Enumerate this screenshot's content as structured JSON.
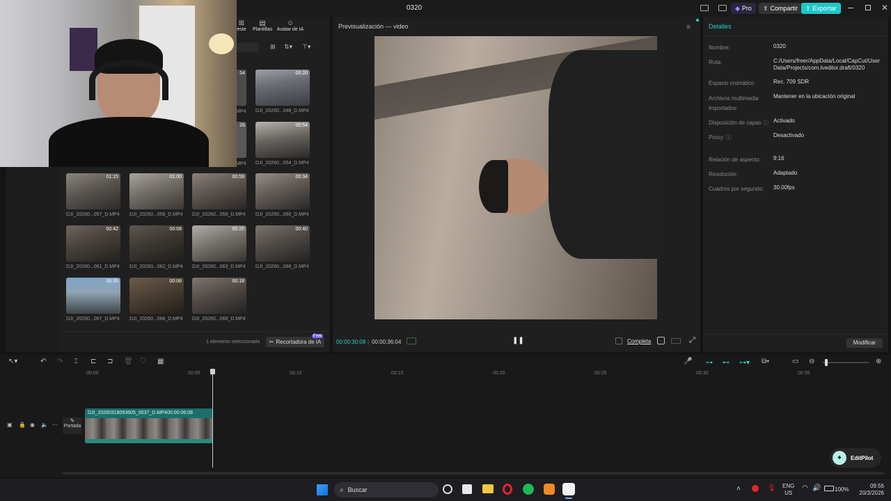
{
  "titlebar": {
    "title": "0320",
    "pro_label": "Pro",
    "share_label": "Compartir",
    "export_label": "Exportar"
  },
  "media_tabs": [
    {
      "label": "este"
    },
    {
      "label": "Plantillas"
    },
    {
      "label": "Avatar de IA"
    }
  ],
  "media_items": [
    {
      "name": "DJI_20260...048_D.MP4",
      "duration": "00:20"
    },
    {
      "name": "DJI_20260...054_D.MP4",
      "duration": "00:54"
    },
    {
      "name": "DJI_20260...057_D.MP4",
      "duration": "01:15"
    },
    {
      "name": "DJI_20260...058_D.MP4",
      "duration": "01:00"
    },
    {
      "name": "DJI_20260...059_D.MP4",
      "duration": "00:59"
    },
    {
      "name": "DJI_20260...060_D.MP4",
      "duration": "00:34"
    },
    {
      "name": "DJI_20260...061_D.MP4",
      "duration": "00:42"
    },
    {
      "name": "DJI_20260...062_D.MP4",
      "duration": "00:08"
    },
    {
      "name": "DJI_20260...063_D.MP4",
      "duration": "00:25"
    },
    {
      "name": "DJI_20260...066_D.MP4",
      "duration": "00:40"
    },
    {
      "name": "DJI_20260...067_D.MP4",
      "duration": "00:35"
    },
    {
      "name": "DJI_20260...068_D.MP4",
      "duration": "00:06"
    },
    {
      "name": "DJI_20260...069_D.MP4",
      "duration": "00:18"
    }
  ],
  "partial_labels": {
    "p1": "54",
    "p2": "MP4",
    "p3": "26",
    "p4": "MP4"
  },
  "media_footer": {
    "selected_text": "1 elemento seleccionado",
    "ai_cutter_label": "Recortadora de IA",
    "free_badge": "Free"
  },
  "preview": {
    "title": "Previsualización — video",
    "current_time": "00:00:30:08",
    "total_time": "00:00:36:04",
    "full_label": "Completa"
  },
  "details": {
    "header": "Detalles",
    "rows": [
      {
        "label": "Nombre:",
        "value": "0320"
      },
      {
        "label": "Ruta:",
        "value": "C:/Users/freer/AppData/Local/CapCut/User Data/Projects/com.lveditor.draft/0320"
      },
      {
        "label": "Espacio cromático",
        "value": "Rec. 709 SDR"
      },
      {
        "label": "Archivos multimedia importados:",
        "value": "Mantener en la ubicación original"
      },
      {
        "label": "Disposición de capas ⓘ",
        "value": "Activado"
      },
      {
        "label": "Proxy: ⓘ",
        "value": "Desactivado"
      },
      {
        "label": "Relación de aspecto:",
        "value": "9:16"
      },
      {
        "label": "Resolución:",
        "value": "Adaptado"
      },
      {
        "label": "Cuadros por segundo:",
        "value": "30.00fps"
      }
    ],
    "modify_label": "Modificar"
  },
  "timeline": {
    "ticks": [
      "00:00",
      "00:05",
      "00:10",
      "00:15",
      "00:20",
      "00:25",
      "00:30",
      "00:35"
    ],
    "clip_name": "DJI_20260318093605_0037_D.MP4",
    "clip_duration": "00:00:06:08",
    "cover_label": "Portada",
    "editpilot_label": "EditPilot"
  },
  "taskbar": {
    "search_placeholder": "Buscar",
    "lang": "ENG",
    "region": "US",
    "battery": "100%",
    "time": "09:56",
    "date": "20/3/2026"
  },
  "colors": {
    "accent": "#22d3c5",
    "pro": "#7c5cff",
    "export": "#1ec8c8"
  }
}
